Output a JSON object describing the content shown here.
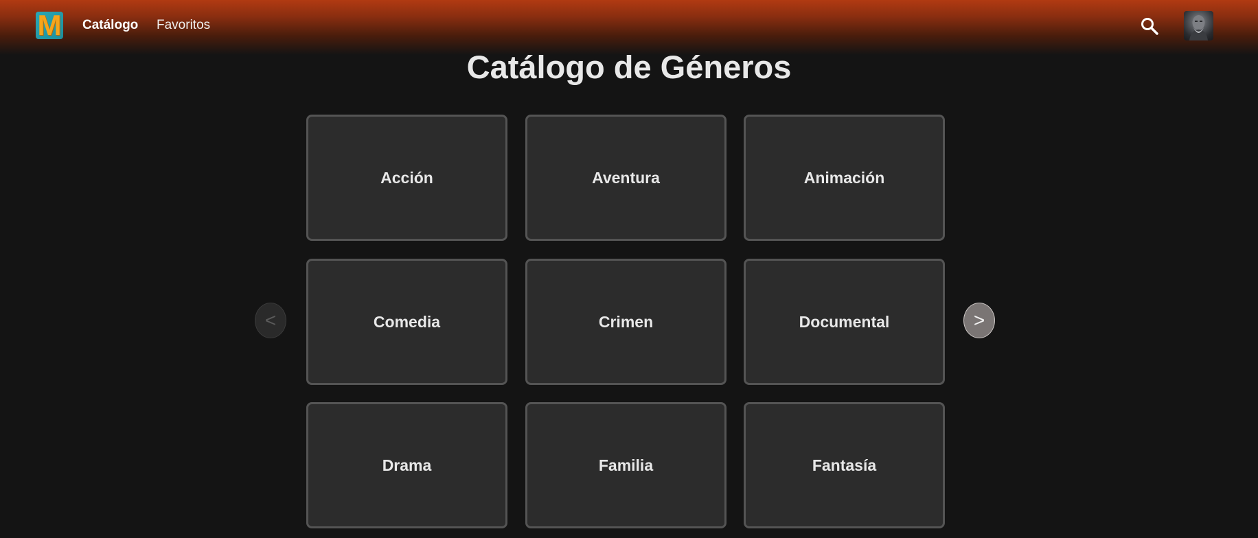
{
  "header": {
    "logo_letter": "M",
    "nav": [
      {
        "label": "Catálogo",
        "active": true
      },
      {
        "label": "Favoritos",
        "active": false
      }
    ],
    "search_icon": "search-icon",
    "avatar_icon": "user-avatar"
  },
  "main": {
    "title": "Catálogo de Géneros",
    "genres": [
      "Acción",
      "Aventura",
      "Animación",
      "Comedia",
      "Crimen",
      "Documental",
      "Drama",
      "Familia",
      "Fantasía"
    ],
    "prev_label": "<",
    "next_label": ">"
  },
  "colors": {
    "header_accent": "#b13a12",
    "background": "#141414",
    "card_bg": "#2c2c2c",
    "card_border": "#545454"
  }
}
